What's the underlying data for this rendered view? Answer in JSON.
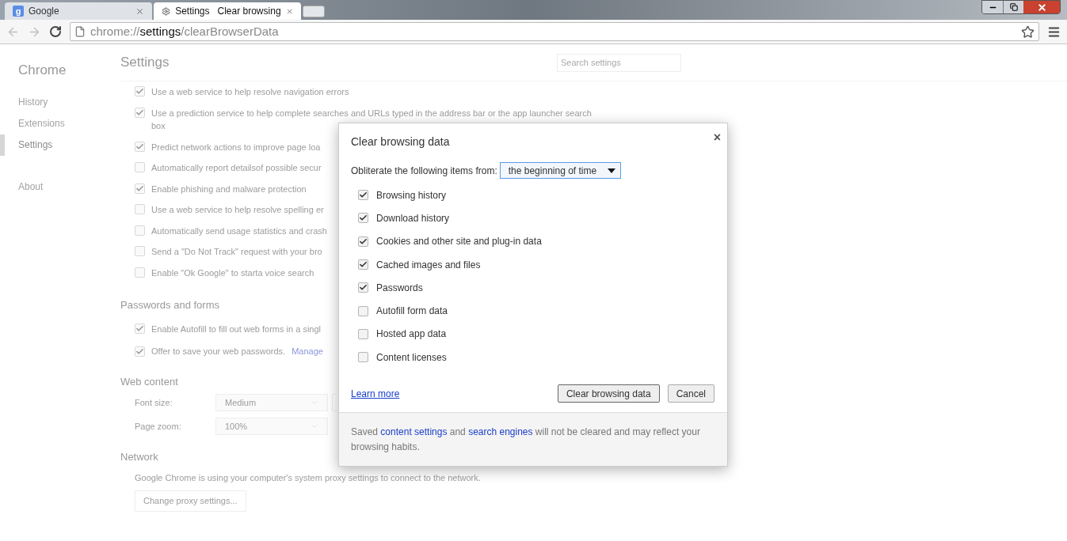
{
  "tabs": [
    {
      "kind": "google",
      "favicon": "g",
      "title": "Google",
      "selected": false
    },
    {
      "kind": "gear",
      "title": "Settings   Clear browsing",
      "selected": true
    }
  ],
  "address": {
    "scheme": "chrome://",
    "host": "settings",
    "path": "/clearBrowserData"
  },
  "sidebar": {
    "title": "Chrome",
    "items": [
      {
        "label": "History",
        "selected": false
      },
      {
        "label": "Extensions",
        "selected": false
      },
      {
        "label": "Settings",
        "selected": true
      },
      {
        "label": "About",
        "selected": false
      }
    ]
  },
  "settings": {
    "title": "Settings",
    "search_placeholder": "Search settings",
    "privacy_options": [
      {
        "label": "Use a web service to help resolve navigation errors",
        "checked": true
      },
      {
        "label": "Use a prediction service to help complete searches and URLs typed in the address bar or the app launcher search box",
        "checked": true
      },
      {
        "label": "Predict network actions to improve page loa",
        "checked": true
      },
      {
        "label": "Automatically report detailsof possible secur",
        "checked": false
      },
      {
        "label": "Enable phishing and malware protection",
        "checked": true
      },
      {
        "label": "Use a web service to help resolve spelling er",
        "checked": false
      },
      {
        "label": "Automatically send usage statistics and crash",
        "checked": false
      },
      {
        "label": "Send a \"Do Not Track\" request with your bro",
        "checked": false
      },
      {
        "label": "Enable \"Ok Google\" to starta voice search",
        "checked": false
      }
    ],
    "passwords_title": "Passwords and forms",
    "password_options": [
      {
        "label": "Enable Autofill to fill out web forms in a singl",
        "checked": true
      },
      {
        "label": "Offer to save your web passwords.",
        "checked": true,
        "link": "Manage"
      }
    ],
    "web_content_title": "Web content",
    "web_content": [
      {
        "label": "Font size:",
        "value": "Medium"
      },
      {
        "label": "Page zoom:",
        "value": "100%"
      }
    ],
    "network_title": "Network",
    "network_text": "Google Chrome is using your computer's system proxy settings to connect to the network.",
    "network_button": "Change proxy settings..."
  },
  "dialog": {
    "title": "Clear browsing data",
    "close": "×",
    "range_label": "Obliterate the following items from:",
    "range_value": "the beginning of time",
    "items": [
      {
        "label": "Browsing history",
        "checked": true
      },
      {
        "label": "Download history",
        "checked": true
      },
      {
        "label": "Cookies and other site and plug-in data",
        "checked": true
      },
      {
        "label": "Cached images and files",
        "checked": true
      },
      {
        "label": "Passwords",
        "checked": true
      },
      {
        "label": "Autofill form data",
        "checked": false
      },
      {
        "label": "Hosted app data",
        "checked": false
      },
      {
        "label": "Content licenses",
        "checked": false
      }
    ],
    "learn_more": "Learn more",
    "buttons": [
      "Clear browsing data",
      "Cancel"
    ],
    "footer": [
      {
        "kind": "text",
        "text": "Saved "
      },
      {
        "kind": "link",
        "text": "content settings"
      },
      {
        "kind": "text",
        "text": " and "
      },
      {
        "kind": "link",
        "text": "search engines"
      },
      {
        "kind": "text",
        "text": " will not be cleared and may reflect your browsing habits."
      }
    ]
  }
}
